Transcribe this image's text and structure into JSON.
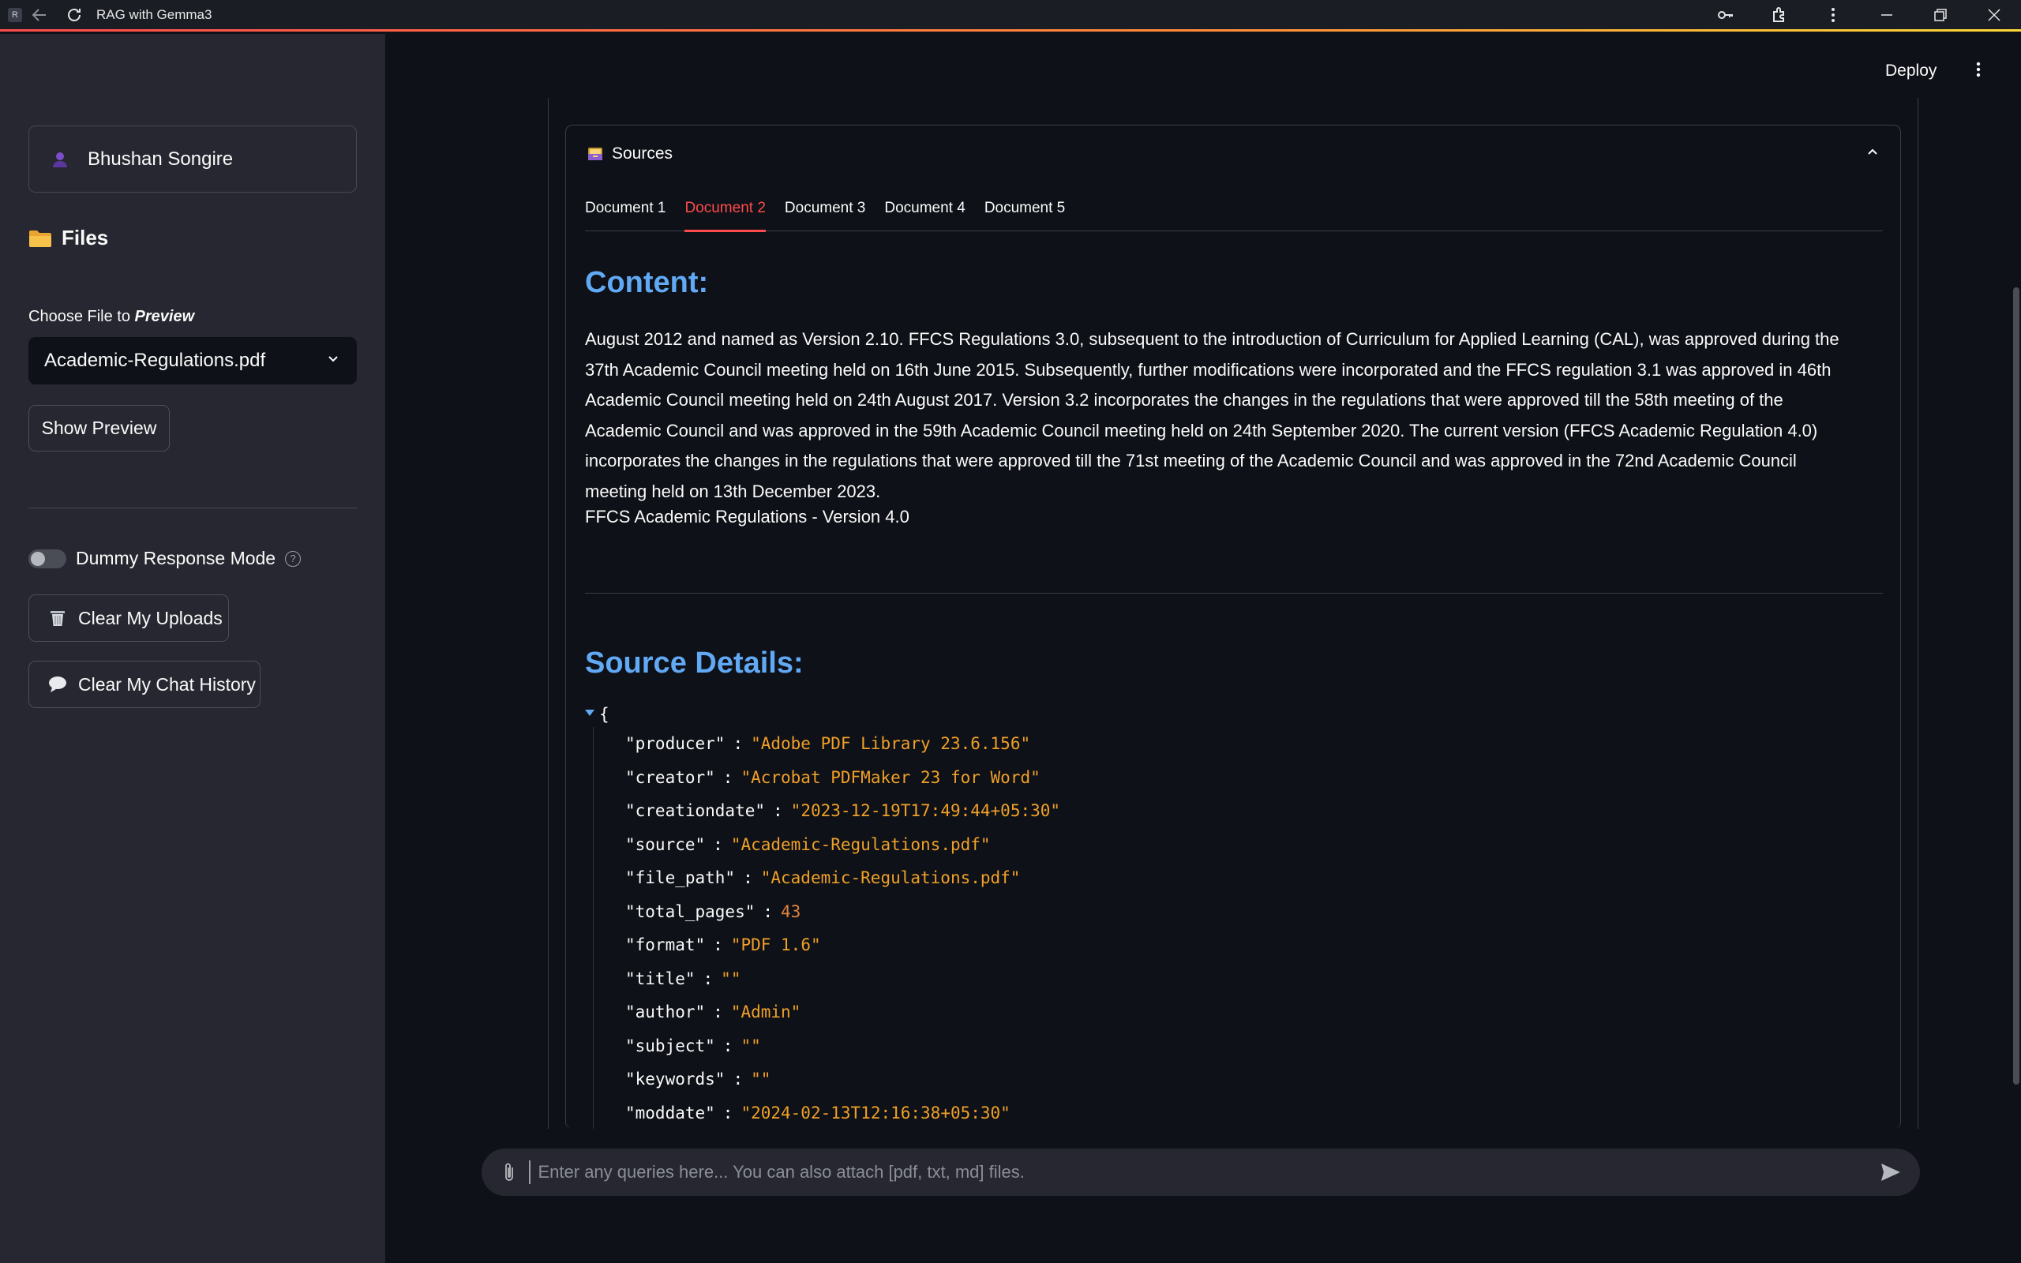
{
  "window": {
    "title": "RAG with Gemma3",
    "app_icon": "R"
  },
  "sidebar": {
    "user_name": "Bhushan Songire",
    "files_heading": "Files",
    "choose_label": "Choose File to ",
    "choose_label_em": "Preview",
    "selected_file": "Academic-Regulations.pdf",
    "show_preview_label": "Show Preview",
    "dummy_mode_label": "Dummy Response Mode",
    "dummy_mode_on": false,
    "clear_uploads_label": "Clear My Uploads",
    "clear_chat_label": "Clear My Chat History"
  },
  "header": {
    "deploy_label": "Deploy"
  },
  "sources": {
    "title": "Sources",
    "tabs": [
      "Document 1",
      "Document 2",
      "Document 3",
      "Document 4",
      "Document 5"
    ],
    "active_tab": 1,
    "content_heading": "Content:",
    "content_lines": [
      "August 2012 and named as Version 2.10. FFCS Regulations 3.0, subsequent to the introduction of Curriculum for Applied Learning (CAL), was approved during the",
      "37th Academic Council meeting held on 16th June 2015. Subsequently, further modifications were incorporated and the FFCS regulation 3.1 was approved in 46th",
      "Academic Council meeting held on 24th August 2017. Version 3.2 incorporates the changes in the regulations that were approved till the 58th meeting of the",
      "Academic Council and was approved in the 59th Academic Council meeting held on 24th September 2020. The current version (FFCS Academic Regulation 4.0)",
      "incorporates the changes in the regulations that were approved till the 71st meeting of the Academic Council and was approved in the 72nd Academic Council",
      "meeting held on 13th December 2023."
    ],
    "content_footer": "FFCS Academic Regulations - Version 4.0",
    "details_heading": "Source Details:",
    "json_open": "{",
    "details": [
      {
        "key": "\"producer\"",
        "value": "\"Adobe PDF Library 23.6.156\"",
        "type": "str"
      },
      {
        "key": "\"creator\"",
        "value": "\"Acrobat PDFMaker 23 for Word\"",
        "type": "str"
      },
      {
        "key": "\"creationdate\"",
        "value": "\"2023-12-19T17:49:44+05:30\"",
        "type": "str"
      },
      {
        "key": "\"source\"",
        "value": "\"Academic-Regulations.pdf\"",
        "type": "str"
      },
      {
        "key": "\"file_path\"",
        "value": "\"Academic-Regulations.pdf\"",
        "type": "str"
      },
      {
        "key": "\"total_pages\"",
        "value": "43",
        "type": "num"
      },
      {
        "key": "\"format\"",
        "value": "\"PDF 1.6\"",
        "type": "str"
      },
      {
        "key": "\"title\"",
        "value": "\"\"",
        "type": "str"
      },
      {
        "key": "\"author\"",
        "value": "\"Admin\"",
        "type": "str"
      },
      {
        "key": "\"subject\"",
        "value": "\"\"",
        "type": "str"
      },
      {
        "key": "\"keywords\"",
        "value": "\"\"",
        "type": "str"
      },
      {
        "key": "\"moddate\"",
        "value": "\"2024-02-13T12:16:38+05:30\"",
        "type": "str"
      }
    ]
  },
  "chat_input": {
    "placeholder": "Enter any queries here... You can also attach [pdf, txt, md] files."
  },
  "colors": {
    "accent": "#ff4b4b",
    "heading_blue": "#61a9f5",
    "json_string": "#f0a028",
    "sidebar_bg": "#262730",
    "main_bg": "#0e1117"
  }
}
